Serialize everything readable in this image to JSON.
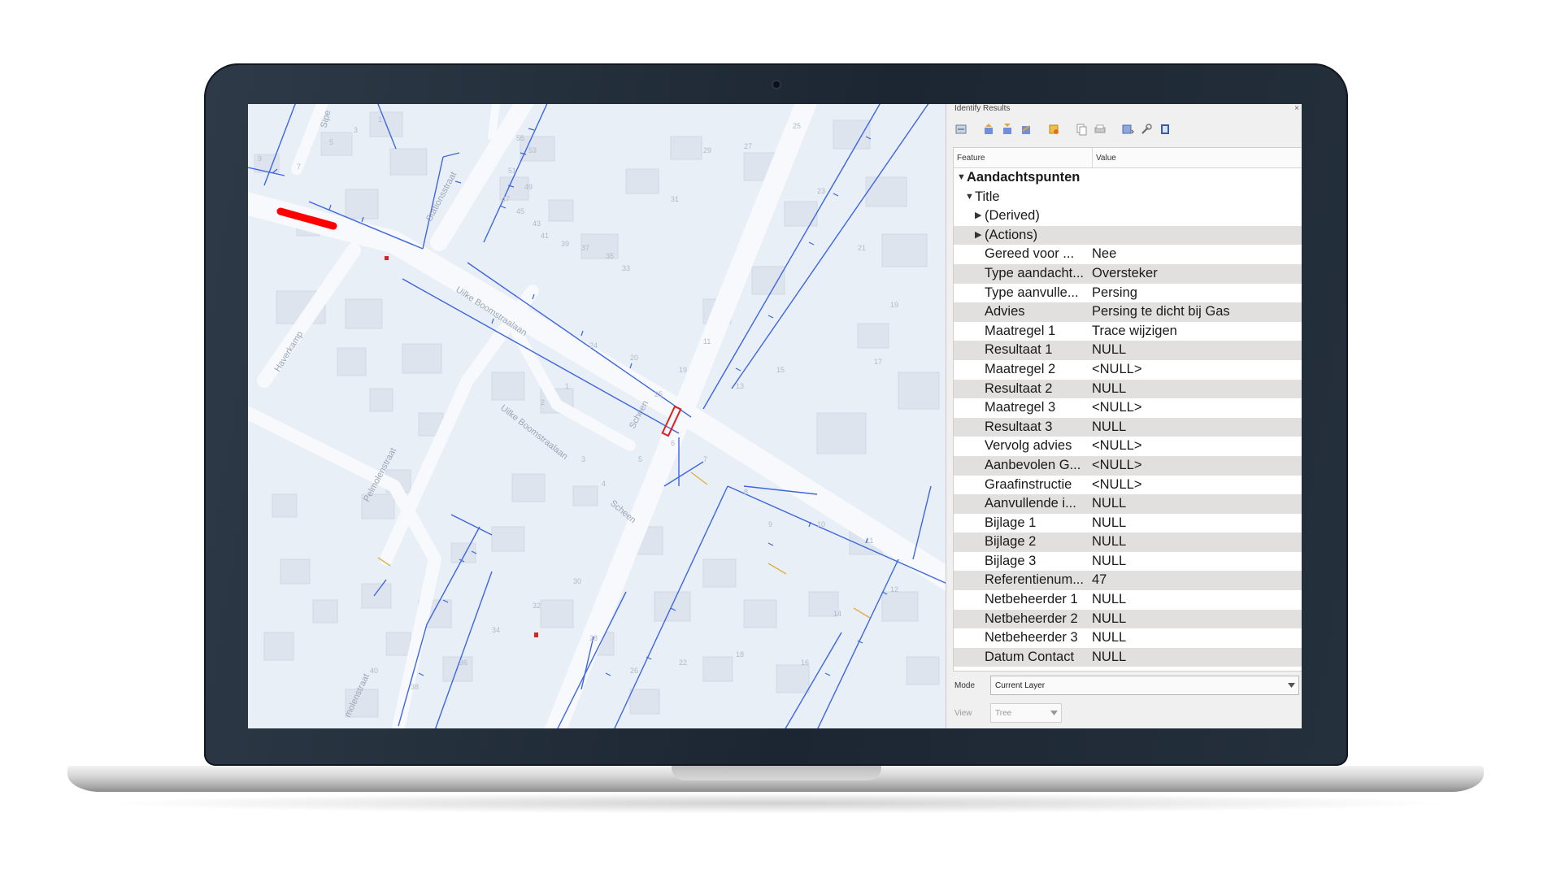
{
  "panel": {
    "title": "Identify Results",
    "close_glyph": "×",
    "toolbar_icons": [
      "expand-tree-icon",
      "expand-all-icon",
      "collapse-all-icon",
      "expand-new-icon",
      "clear-results-icon",
      "copy-feature-icon",
      "print-icon",
      "select-feature-icon",
      "identify-settings-icon",
      "help-icon"
    ],
    "columns": {
      "feature": "Feature",
      "value": "Value"
    },
    "layer_name": "Aandachtspunten",
    "title_node": "Title",
    "derived": "(Derived)",
    "actions": "(Actions)",
    "attributes": [
      {
        "key": "Gereed voor ...",
        "value": "Nee"
      },
      {
        "key": "Type aandacht...",
        "value": "Oversteker"
      },
      {
        "key": "Type aanvulle...",
        "value": "Persing"
      },
      {
        "key": "Advies",
        "value": "Persing te dicht bij Gas"
      },
      {
        "key": "Maatregel 1",
        "value": "Trace wijzigen"
      },
      {
        "key": "Resultaat 1",
        "value": "NULL"
      },
      {
        "key": "Maatregel 2",
        "value": "<NULL>"
      },
      {
        "key": "Resultaat 2",
        "value": "NULL"
      },
      {
        "key": "Maatregel 3",
        "value": "<NULL>"
      },
      {
        "key": "Resultaat 3",
        "value": "NULL"
      },
      {
        "key": "Vervolg advies",
        "value": "<NULL>"
      },
      {
        "key": "Aanbevolen G...",
        "value": "<NULL>"
      },
      {
        "key": "Graafinstructie",
        "value": "<NULL>"
      },
      {
        "key": "Aanvullende i...",
        "value": "NULL"
      },
      {
        "key": "Bijlage 1",
        "value": "NULL"
      },
      {
        "key": "Bijlage 2",
        "value": "NULL"
      },
      {
        "key": "Bijlage 3",
        "value": "NULL"
      },
      {
        "key": "Referentienum...",
        "value": "47"
      },
      {
        "key": "Netbeheerder 1",
        "value": "NULL"
      },
      {
        "key": "Netbeheerder 2",
        "value": "NULL"
      },
      {
        "key": "Netbeheerder 3",
        "value": "NULL"
      },
      {
        "key": "Datum Contact",
        "value": "NULL"
      }
    ],
    "mode": {
      "label": "Mode",
      "value": "Current Layer"
    },
    "view": {
      "label": "View",
      "value": "Tree"
    }
  },
  "map": {
    "street_labels": [
      "Sipe",
      "Stationsstraat",
      "Uilke Boomstraalaan",
      "Haverkamp",
      "Uilke Boomstraalaan",
      "Scheen",
      "Scheen",
      "Pelmolenstraat",
      "molenstraat"
    ],
    "house_numbers": [
      "9",
      "7",
      "5",
      "3",
      "1",
      "55",
      "53",
      "51",
      "49",
      "47",
      "45",
      "43",
      "41",
      "39",
      "37",
      "35",
      "33",
      "31",
      "29",
      "27",
      "25",
      "23",
      "21",
      "19",
      "17",
      "15",
      "13",
      "11",
      "19",
      "25",
      "24",
      "20",
      "1",
      "2",
      "3",
      "4",
      "5",
      "6",
      "7",
      "8",
      "9",
      "10",
      "11",
      "12",
      "14",
      "16",
      "18",
      "22",
      "26",
      "28",
      "30",
      "32",
      "34",
      "36",
      "38",
      "40"
    ],
    "colors": {
      "background": "#e9eff7",
      "road": "#f7f9fc",
      "pipe": "#3d66e0",
      "highlight": "#ff0000",
      "gas": "#e0b040",
      "building": "#dde4ee"
    }
  }
}
